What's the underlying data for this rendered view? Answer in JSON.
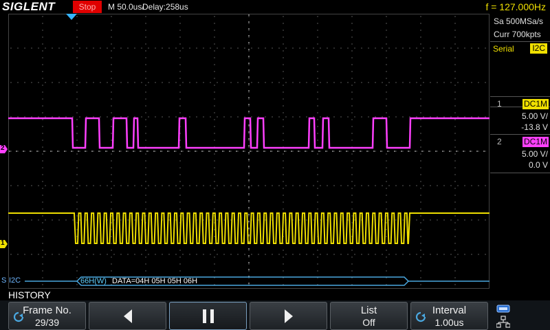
{
  "topbar": {
    "brand": "SIGLENT",
    "run_state": "Stop",
    "timebase": "M 50.0us/",
    "delay": "Delay:258us",
    "frequency": "f = 127.000Hz"
  },
  "acquire": {
    "sample_rate": "Sa 500MSa/s",
    "curr_points": "Curr 700kpts"
  },
  "serial": {
    "label": "Serial",
    "protocol": "I2C"
  },
  "channels": [
    {
      "num": "1",
      "coupling": "DC1M",
      "scale": "5.00 V/",
      "offset": "-13.8 V",
      "color": "#f0e000"
    },
    {
      "num": "2",
      "coupling": "DC1M",
      "scale": "5.00 V/",
      "offset": "0.0 V",
      "color": "#ff40ff"
    }
  ],
  "decode": {
    "source_marker": "S",
    "label": "I2C",
    "address": "66H(W)",
    "data": "DATA=04H 05H 05H 06H"
  },
  "history": {
    "title": "HISTORY"
  },
  "softkeys": {
    "frame_label": "Frame No.",
    "frame_value": "29/39",
    "list_label": "List",
    "list_value": "Off",
    "interval_label": "Interval",
    "interval_value": "1.00us"
  },
  "markers": {
    "ch1": "1",
    "ch2": "2"
  },
  "icons": {
    "prev": "triangle-left-icon",
    "play": "pause-icon",
    "next": "triangle-right-icon",
    "knob": "rotary-knob-icon",
    "usb": "usb-icon",
    "network": "network-icon",
    "trigger": "trigger-position-icon"
  },
  "colors": {
    "ch1": "#f0e000",
    "ch2": "#ff40ff",
    "decode": "#4aa8e0",
    "run_state_bg": "#e00000"
  }
}
